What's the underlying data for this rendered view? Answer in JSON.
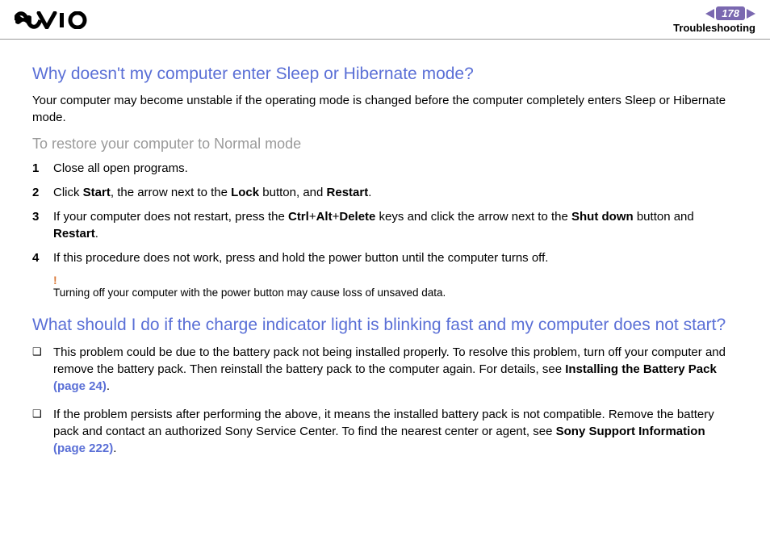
{
  "header": {
    "page_number": "178",
    "section": "Troubleshooting"
  },
  "content": {
    "q1": {
      "heading": "Why doesn't my computer enter Sleep or Hibernate mode?",
      "intro": "Your computer may become unstable if the operating mode is changed before the computer completely enters Sleep or Hibernate mode.",
      "subheading": "To restore your computer to Normal mode",
      "steps": {
        "s1": "Close all open programs.",
        "s2_a": "Click ",
        "s2_b_start": "Start",
        "s2_c": ", the arrow next to the ",
        "s2_b_lock": "Lock",
        "s2_d": " button, and ",
        "s2_b_restart": "Restart",
        "s2_e": ".",
        "s3_a": "If your computer does not restart, press the ",
        "s3_b_ctrl": "Ctrl",
        "s3_plus1": "+",
        "s3_b_alt": "Alt",
        "s3_plus2": "+",
        "s3_b_del": "Delete",
        "s3_c": " keys and click the arrow next to the ",
        "s3_b_shut": "Shut down",
        "s3_d": " button and ",
        "s3_b_restart": "Restart",
        "s3_e": ".",
        "s4": "If this procedure does not work, press and hold the power button until the computer turns off."
      },
      "warning": {
        "bang": "!",
        "text": "Turning off your computer with the power button may cause loss of unsaved data."
      }
    },
    "q2": {
      "heading": "What should I do if the charge indicator light is blinking fast and my computer does not start?",
      "bullets": {
        "b1_a": "This problem could be due to the battery pack not being installed properly. To resolve this problem, turn off your computer and remove the battery pack. Then reinstall the battery pack to the computer again. For details, see ",
        "b1_b_inst": "Installing the Battery Pack ",
        "b1_link": "(page 24)",
        "b1_c": ".",
        "b2_a": "If the problem persists after performing the above, it means the installed battery pack is not compatible. Remove the battery pack and contact an authorized Sony Service Center. To find the nearest center or agent, see ",
        "b2_b_sony": "Sony Support Information ",
        "b2_link": "(page 222)",
        "b2_c": "."
      }
    }
  }
}
